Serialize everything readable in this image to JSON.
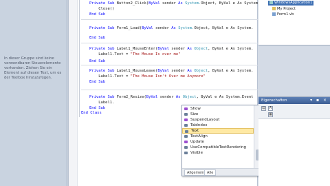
{
  "toolbox": {
    "message": "In dieser Gruppe sind keine verwendbaren Steuerelemente vorhanden. Ziehen Sie ein Element auf diesen Text, um es der Toolbox hinzuzufügen."
  },
  "code": {
    "lines": [
      {
        "kw": "Private Sub ",
        "name": "Button2_Click(",
        "kw2": "ByVal ",
        "rest": "sender ",
        "kw3": "As ",
        "ty": "System.",
        "rest2": "Object, ByVal e As System."
      },
      {
        "plain": "    Close()"
      },
      {
        "kw": "End Sub"
      },
      {
        "kw": "Private Sub ",
        "name": "Form1_Load(",
        "kw2": "ByVal ",
        "rest": "sender ",
        "kw3": "As ",
        "ty": "System.",
        "rest2": "Object, ByVal e As System."
      },
      {
        "kw": "End Sub"
      },
      {
        "kw": "Private Sub ",
        "name": "Label1_MouseEnter(",
        "kw2": "ByVal ",
        "rest": "sender ",
        "kw3": "As ",
        "ty": "Object",
        "rest2": ", ByVal e As System."
      },
      {
        "plain": "    Label1.Text = ",
        "str": "\"The Mouse Is over me\""
      },
      {
        "kw": "End Sub"
      },
      {
        "kw": "Private Sub ",
        "name": "Label1_MouseLeave(",
        "kw2": "ByVal ",
        "rest": "sender ",
        "kw3": "As ",
        "ty": "Object",
        "rest2": ", ByVal e As System."
      },
      {
        "plain": "    Label1.Text = ",
        "str": "\"The Mouse Isn't Over me Anymore\""
      },
      {
        "kw": "End Sub"
      },
      {
        "kw": "Private Sub ",
        "name": "Form2_Resize(",
        "kw2": "ByVal ",
        "rest": "sender ",
        "kw3": "As ",
        "ty": "Object",
        "rest2": ", ByVal e As System.Event"
      },
      {
        "plain": "    Label1."
      },
      {
        "kw": "End Sub"
      },
      {
        "kw": "End Class"
      }
    ]
  },
  "intellisense": {
    "items": [
      {
        "label": "Show",
        "kind": "method"
      },
      {
        "label": "Size",
        "kind": "prop"
      },
      {
        "label": "SuspendLayout",
        "kind": "method"
      },
      {
        "label": "TabIndex",
        "kind": "prop"
      },
      {
        "label": "Text",
        "kind": "prop",
        "selected": true
      },
      {
        "label": "TextAlign",
        "kind": "prop"
      },
      {
        "label": "Update",
        "kind": "method"
      },
      {
        "label": "UseCompatibleTextRendering",
        "kind": "prop"
      },
      {
        "label": "Visible",
        "kind": "prop"
      }
    ],
    "tabs": [
      "Allgemein",
      "Alle"
    ]
  },
  "solution_explorer": {
    "items": [
      "WindowsApplication1",
      "My Project",
      "Form1.vb"
    ]
  },
  "properties": {
    "title": "Eigenschaften",
    "buttons": "▾ ▪ ×"
  }
}
